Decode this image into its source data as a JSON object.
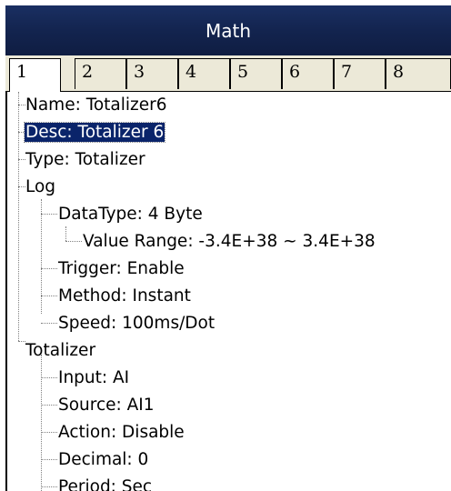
{
  "window": {
    "title": "Math"
  },
  "tabs": [
    "1",
    "2",
    "3",
    "4",
    "5",
    "6",
    "7",
    "8"
  ],
  "tree": {
    "name": "Name: Totalizer6",
    "desc": "Desc: Totalizer 6",
    "type": "Type: Totalizer",
    "log": {
      "label": "Log",
      "datatype": "DataType: 4 Byte",
      "value_range": "Value Range: -3.4E+38  ~ 3.4E+38",
      "trigger": "Trigger: Enable",
      "method": "Method: Instant",
      "speed": "Speed: 100ms/Dot"
    },
    "totalizer": {
      "label": "Totalizer",
      "input": "Input: AI",
      "source": "Source: AI1",
      "action": "Action: Disable",
      "decimal": "Decimal: 0",
      "period": "Period: Sec"
    }
  },
  "colors": {
    "title_bar": "#13244f",
    "selection": "#0a246a"
  }
}
